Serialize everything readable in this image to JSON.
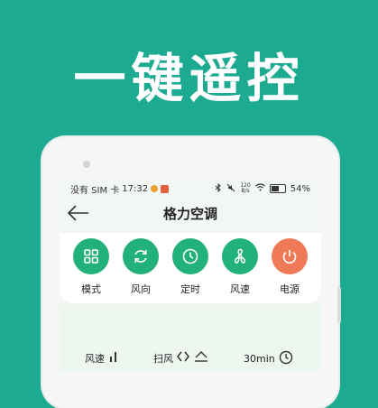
{
  "headline": "一键遥控",
  "status": {
    "sim": "没有 SIM 卡",
    "time": "17:32",
    "net_top": "120",
    "net_bottom": "B/s",
    "battery": "54%"
  },
  "titlebar": {
    "title": "格力空调"
  },
  "controls": [
    {
      "label": "模式",
      "icon": "grid-icon"
    },
    {
      "label": "风向",
      "icon": "refresh-icon"
    },
    {
      "label": "定时",
      "icon": "clock-icon"
    },
    {
      "label": "风速",
      "icon": "fan-icon"
    },
    {
      "label": "电源",
      "icon": "power-icon"
    }
  ],
  "bottom": {
    "speed_label": "风速",
    "sweep_label": "扫风",
    "timer_label": "30min"
  },
  "colors": {
    "background": "#1caa91",
    "button_green": "#22b07b",
    "power_orange": "#f07a58"
  }
}
